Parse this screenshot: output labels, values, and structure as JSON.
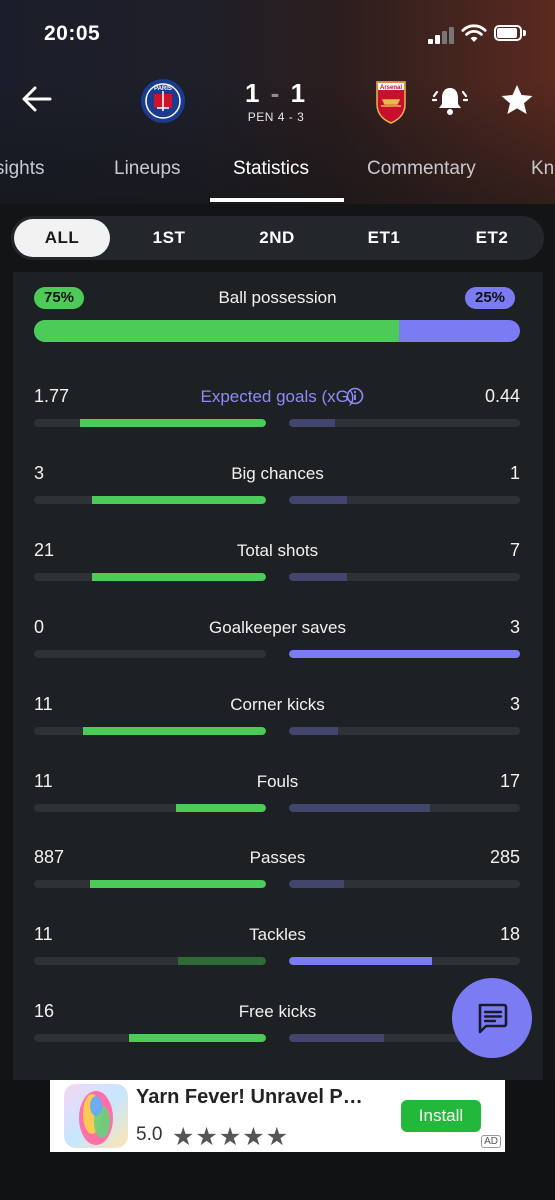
{
  "status_bar": {
    "time": "20:05"
  },
  "match": {
    "home_score": "1",
    "away_score": "1",
    "separator": "-",
    "penalties": "PEN 4 - 3",
    "home_crest_text": "PARIS",
    "away_crest_text": "Arsenal"
  },
  "tabs": [
    {
      "label": "Insights"
    },
    {
      "label": "Lineups"
    },
    {
      "label": "Statistics",
      "active": true
    },
    {
      "label": "Commentary"
    },
    {
      "label": "Knockout"
    }
  ],
  "periods": [
    {
      "label": "ALL",
      "active": true
    },
    {
      "label": "1ST"
    },
    {
      "label": "2ND"
    },
    {
      "label": "ET1"
    },
    {
      "label": "ET2"
    }
  ],
  "possession": {
    "label": "Ball possession",
    "home": "75%",
    "away": "25%",
    "home_fraction": 0.75
  },
  "colors": {
    "home": "#4ccb58",
    "home_dim": "#2f6a39",
    "away": "#7b7cf4",
    "away_dim": "#43466c",
    "accent": "#7b7cf4"
  },
  "stats": [
    {
      "label": "Expected goals (xG)",
      "home": "1.77",
      "away": "0.44",
      "home_frac": 0.8,
      "away_frac": 0.2,
      "xg": true,
      "lead": "home"
    },
    {
      "label": "Big chances",
      "home": "3",
      "away": "1",
      "home_frac": 0.75,
      "away_frac": 0.25,
      "lead": "home"
    },
    {
      "label": "Total shots",
      "home": "21",
      "away": "7",
      "home_frac": 0.75,
      "away_frac": 0.25,
      "lead": "home"
    },
    {
      "label": "Goalkeeper saves",
      "home": "0",
      "away": "3",
      "home_frac": 0.0,
      "away_frac": 1.0,
      "lead": "away"
    },
    {
      "label": "Corner kicks",
      "home": "11",
      "away": "3",
      "home_frac": 0.79,
      "away_frac": 0.21,
      "lead": "home"
    },
    {
      "label": "Fouls",
      "home": "11",
      "away": "17",
      "home_frac": 0.39,
      "away_frac": 0.61,
      "lead": "home"
    },
    {
      "label": "Passes",
      "home": "887",
      "away": "285",
      "home_frac": 0.76,
      "away_frac": 0.24,
      "lead": "home"
    },
    {
      "label": "Tackles",
      "home": "11",
      "away": "18",
      "home_frac": 0.38,
      "away_frac": 0.62,
      "lead": "away"
    },
    {
      "label": "Free kicks",
      "home": "16",
      "away": "",
      "home_frac": 0.59,
      "away_frac": 0.41,
      "lead": "home"
    }
  ],
  "ad": {
    "title": "Yarn Fever! Unravel P…",
    "rating": "5.0",
    "stars": "★★★★★",
    "install": "Install",
    "tag": "AD"
  }
}
